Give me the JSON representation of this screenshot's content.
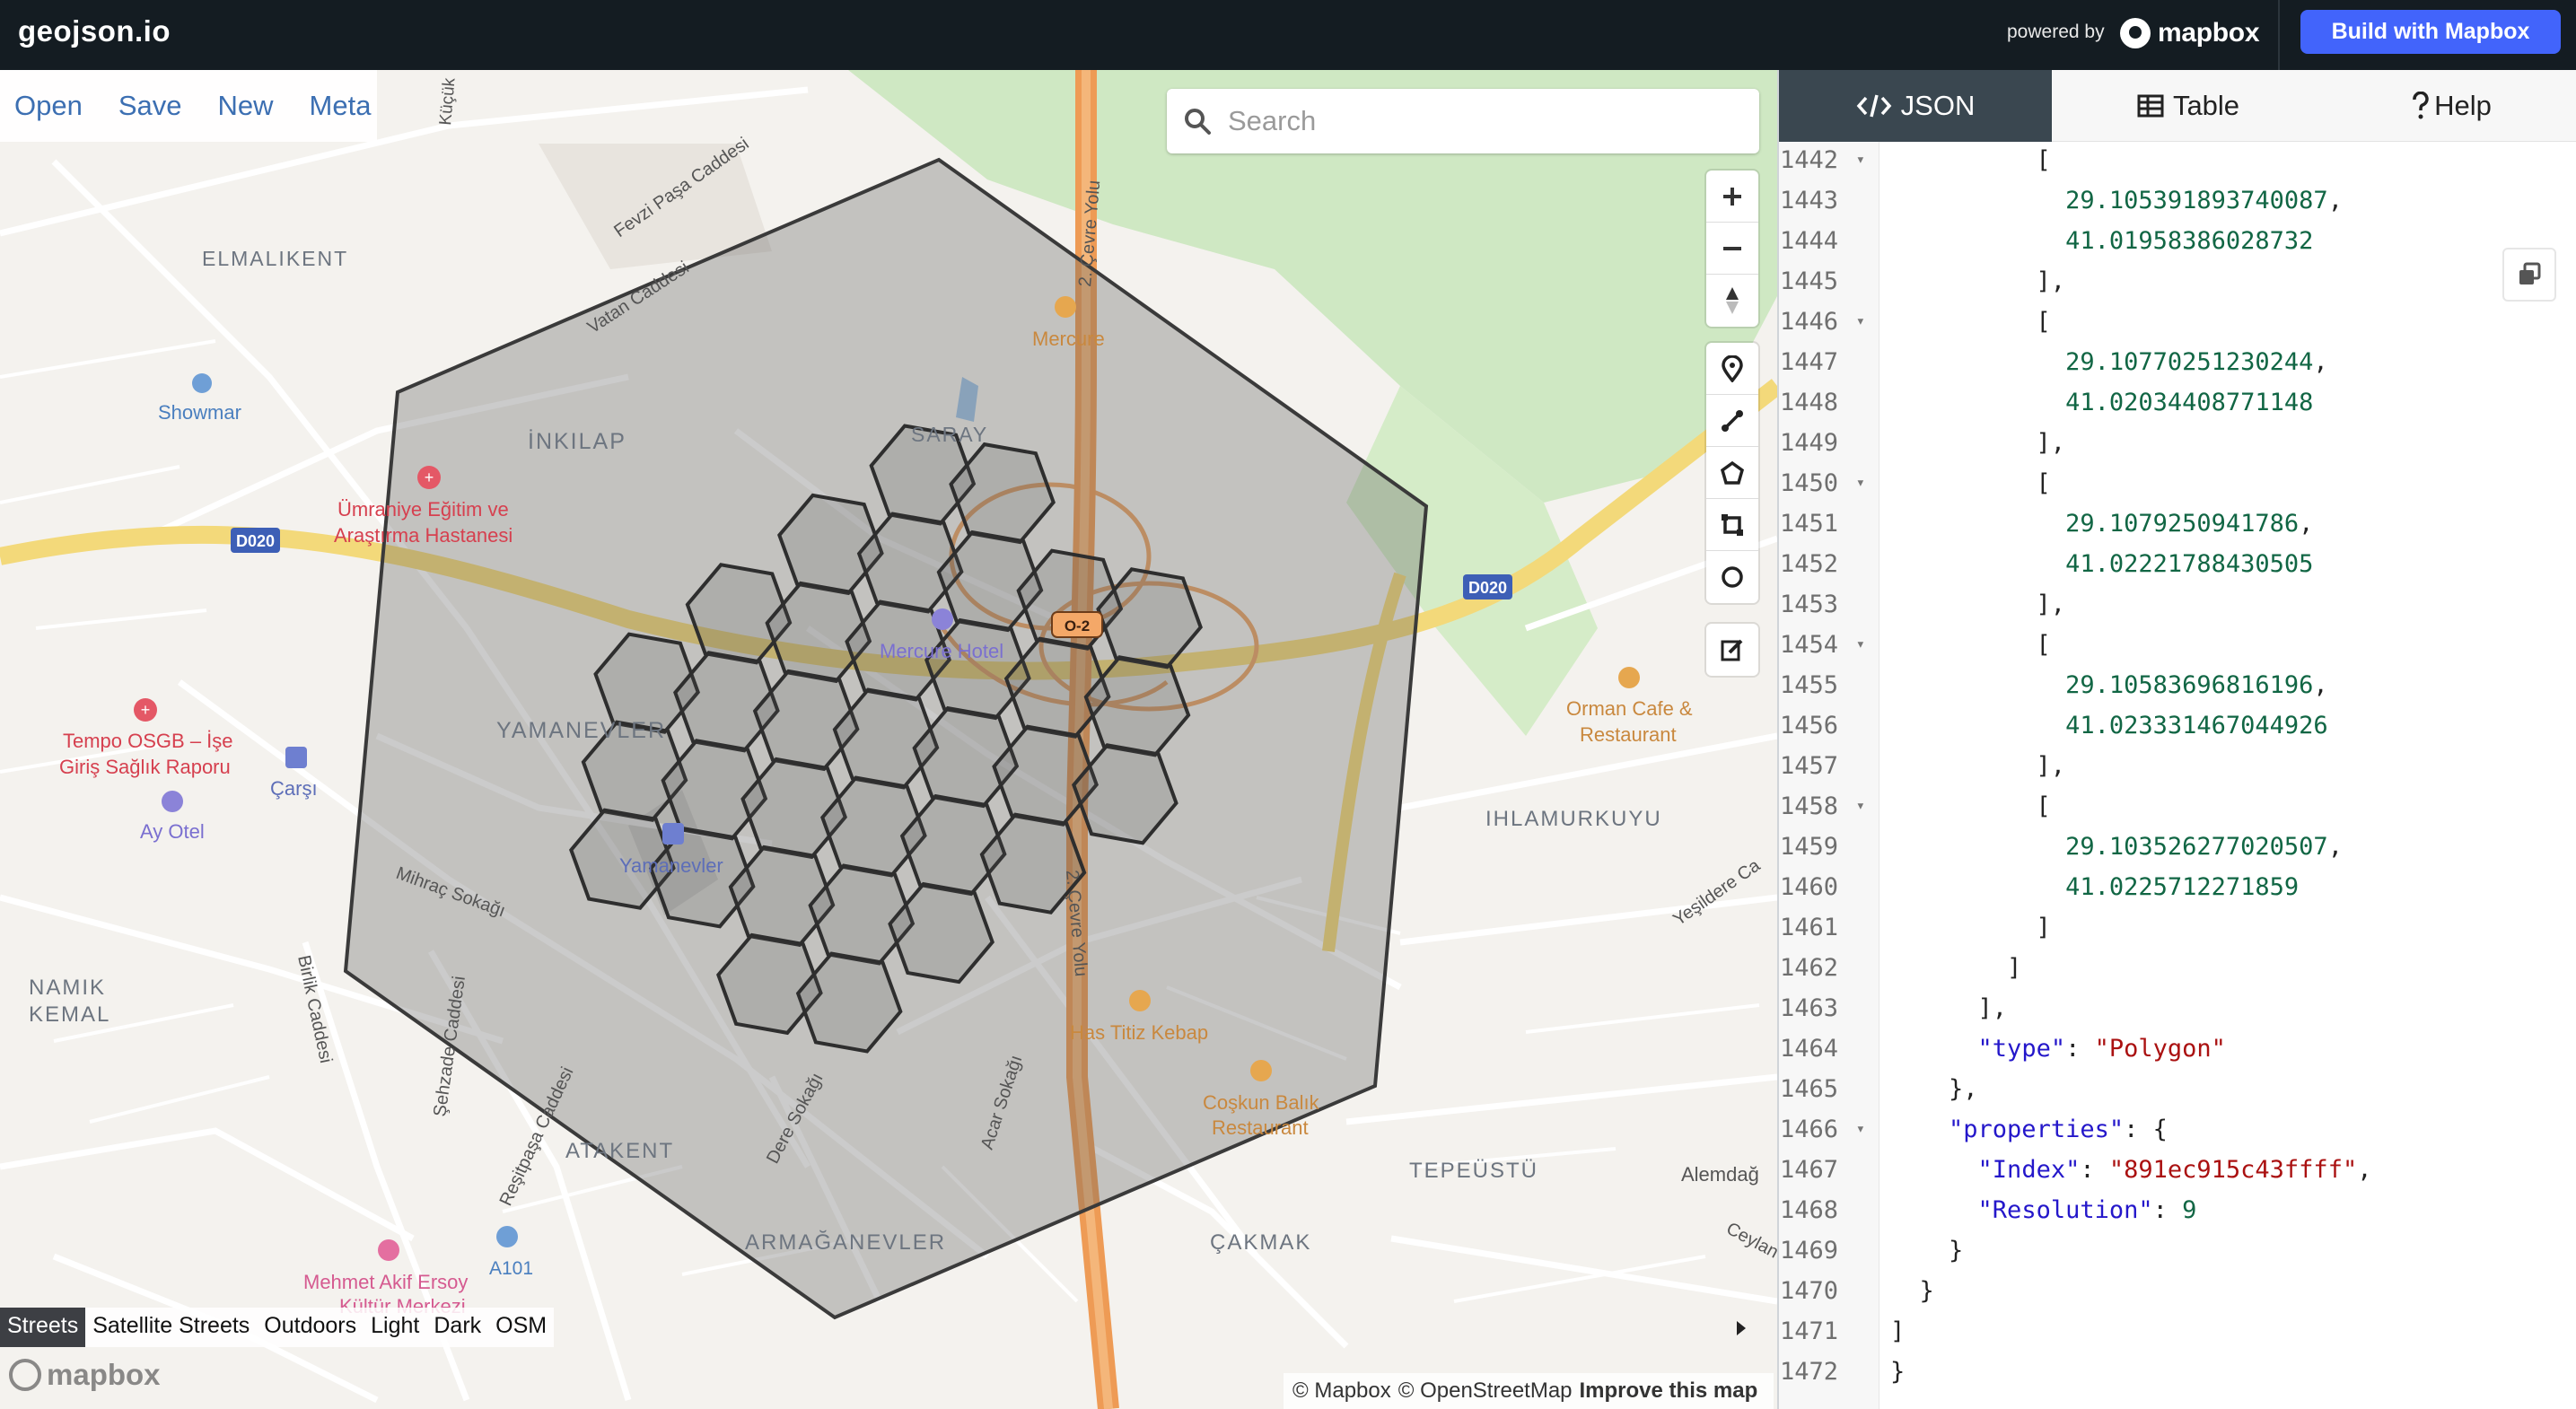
{
  "app": {
    "title": "geojson.io"
  },
  "header": {
    "powered_by": "powered by",
    "brand": "mapbox",
    "build_button": "Build with Mapbox"
  },
  "menu": {
    "items": [
      "Open",
      "Save",
      "New",
      "Meta"
    ]
  },
  "search": {
    "placeholder": "Search",
    "value": ""
  },
  "map_controls": {
    "nav": [
      "zoom-in-icon",
      "zoom-out-icon",
      "compass-icon"
    ],
    "draw": [
      "marker-icon",
      "line-icon",
      "polygon-icon",
      "rectangle-icon",
      "circle-icon"
    ],
    "edit": "edit-icon"
  },
  "map_styles": {
    "items": [
      "Streets",
      "Satellite Streets",
      "Outdoors",
      "Light",
      "Dark",
      "OSM"
    ],
    "active": "Streets"
  },
  "map_labels": {
    "districts": [
      "ELMALIKENT",
      "İNKILAP",
      "SARAY",
      "YAMANEVLER",
      "NAMIK KEMAL",
      "IHLAMURKUYU",
      "ATAKENT",
      "ARMAĞANEVLER",
      "TEPEÜSTÜ",
      "ÇAKMAK"
    ],
    "streets": [
      "Fevzi Paşa Caddesi",
      "Vatan Caddesi",
      "2. Çevre Yolu",
      "Mihraç Sokağı",
      "Birlik Caddesi",
      "Şehzade Caddesi",
      "Reşitpaşa Caddesi",
      "Dere Sokağı",
      "Acar Sokağı",
      "Yeşildere Ca",
      "Alemdağ",
      "Ceylan",
      "Küçük"
    ],
    "pois": [
      "Showmar",
      "Ümraniye Eğitim ve",
      "Araştırma Hastanesi",
      "Mercure Hotel",
      "Tempo OSGB – İşe",
      "Giriş Sağlık Raporu",
      "Çarşı",
      "Ay Otel",
      "Yamanevler",
      "Mercure",
      "Orman Cafe &",
      "Restaurant",
      "Has Titiz Kebap",
      "Coşkun Balık",
      "Restaurant",
      "Mehmet Akif Ersoy",
      "Kültür Merkezi",
      "A101"
    ],
    "road_shields": [
      "D020",
      "D020",
      "O-2"
    ]
  },
  "attribution": {
    "mapbox": "© Mapbox",
    "osm": "© OpenStreetMap",
    "improve": "Improve this map",
    "watermark": "mapbox"
  },
  "colors": {
    "header_bg": "#141c22",
    "accent_blue": "#4264fb",
    "menu_link": "#3c6fb2",
    "active_tab": "#3a4750",
    "hex_fill": "#5a5a5a",
    "hex_stroke": "#2e2e2e"
  },
  "panel": {
    "tabs": [
      {
        "label": "JSON",
        "icon": "code-icon"
      },
      {
        "label": "Table",
        "icon": "table-icon"
      },
      {
        "label": "Help",
        "icon": "question-icon"
      }
    ],
    "active_tab": "JSON",
    "code_lines": [
      {
        "num": "1442",
        "fold": true,
        "text": "          ["
      },
      {
        "num": "1443",
        "fold": false,
        "text": "            29.105391893740087,"
      },
      {
        "num": "1444",
        "fold": false,
        "text": "            41.01958386028732"
      },
      {
        "num": "1445",
        "fold": false,
        "text": "          ],"
      },
      {
        "num": "1446",
        "fold": true,
        "text": "          ["
      },
      {
        "num": "1447",
        "fold": false,
        "text": "            29.10770251230244,"
      },
      {
        "num": "1448",
        "fold": false,
        "text": "            41.02034408771148"
      },
      {
        "num": "1449",
        "fold": false,
        "text": "          ],"
      },
      {
        "num": "1450",
        "fold": true,
        "text": "          ["
      },
      {
        "num": "1451",
        "fold": false,
        "text": "            29.1079250941786,"
      },
      {
        "num": "1452",
        "fold": false,
        "text": "            41.02221788430505"
      },
      {
        "num": "1453",
        "fold": false,
        "text": "          ],"
      },
      {
        "num": "1454",
        "fold": true,
        "text": "          ["
      },
      {
        "num": "1455",
        "fold": false,
        "text": "            29.10583696816196,"
      },
      {
        "num": "1456",
        "fold": false,
        "text": "            41.023331467044926"
      },
      {
        "num": "1457",
        "fold": false,
        "text": "          ],"
      },
      {
        "num": "1458",
        "fold": true,
        "text": "          ["
      },
      {
        "num": "1459",
        "fold": false,
        "text": "            29.103526277020507,"
      },
      {
        "num": "1460",
        "fold": false,
        "text": "            41.0225712271859"
      },
      {
        "num": "1461",
        "fold": false,
        "text": "          ]"
      },
      {
        "num": "1462",
        "fold": false,
        "text": "        ]"
      },
      {
        "num": "1463",
        "fold": false,
        "text": "      ],"
      },
      {
        "num": "1464",
        "fold": false,
        "text": "      \"type\": \"Polygon\""
      },
      {
        "num": "1465",
        "fold": false,
        "text": "    },"
      },
      {
        "num": "1466",
        "fold": true,
        "text": "    \"properties\": {"
      },
      {
        "num": "1467",
        "fold": false,
        "text": "      \"Index\": \"891ec915c43ffff\","
      },
      {
        "num": "1468",
        "fold": false,
        "text": "      \"Resolution\": 9"
      },
      {
        "num": "1469",
        "fold": false,
        "text": "    }"
      },
      {
        "num": "1470",
        "fold": false,
        "text": "  }"
      },
      {
        "num": "1471",
        "fold": false,
        "text": "]"
      },
      {
        "num": "1472",
        "fold": false,
        "text": "}"
      }
    ]
  }
}
